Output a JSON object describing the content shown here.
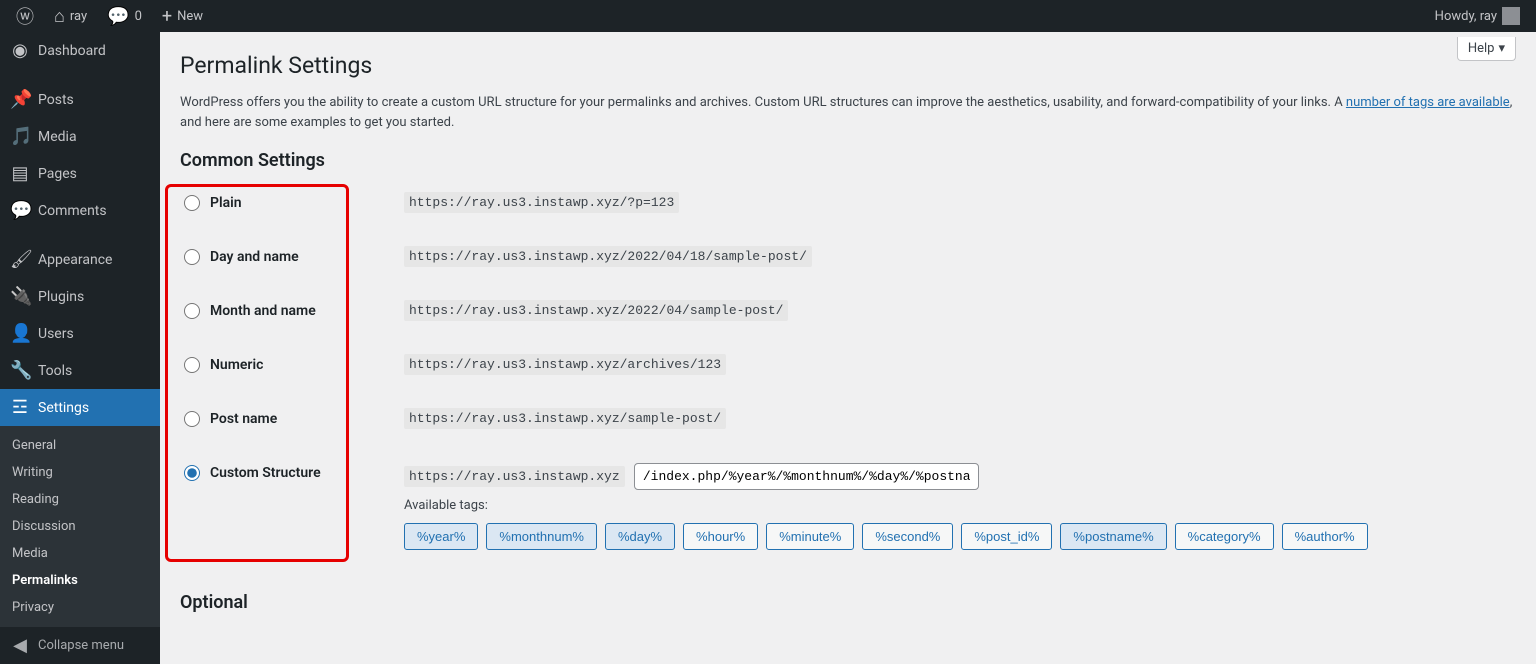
{
  "topbar": {
    "site": "ray",
    "comments": "0",
    "new": "New",
    "howdy": "Howdy, ray"
  },
  "menu": {
    "dashboard": "Dashboard",
    "posts": "Posts",
    "media": "Media",
    "pages": "Pages",
    "comments": "Comments",
    "appearance": "Appearance",
    "plugins": "Plugins",
    "users": "Users",
    "tools": "Tools",
    "settings": "Settings",
    "collapse": "Collapse menu"
  },
  "submenu": {
    "general": "General",
    "writing": "Writing",
    "reading": "Reading",
    "discussion": "Discussion",
    "media": "Media",
    "permalinks": "Permalinks",
    "privacy": "Privacy"
  },
  "help": "Help",
  "title": "Permalink Settings",
  "intro1": "WordPress offers you the ability to create a custom URL structure for your permalinks and archives. Custom URL structures can improve the aesthetics, usability, and forward-compatibility of your links. A ",
  "intro_link": "number of tags are available",
  "intro2": ", and here are some examples to get you started.",
  "common_heading": "Common Settings",
  "options": {
    "plain": {
      "label": "Plain",
      "example": "https://ray.us3.instawp.xyz/?p=123"
    },
    "day": {
      "label": "Day and name",
      "example": "https://ray.us3.instawp.xyz/2022/04/18/sample-post/"
    },
    "month": {
      "label": "Month and name",
      "example": "https://ray.us3.instawp.xyz/2022/04/sample-post/"
    },
    "numeric": {
      "label": "Numeric",
      "example": "https://ray.us3.instawp.xyz/archives/123"
    },
    "postname": {
      "label": "Post name",
      "example": "https://ray.us3.instawp.xyz/sample-post/"
    },
    "custom": {
      "label": "Custom Structure",
      "prefix": "https://ray.us3.instawp.xyz",
      "value": "/index.php/%year%/%monthnum%/%day%/%postnam"
    }
  },
  "available_label": "Available tags:",
  "tags": [
    "%year%",
    "%monthnum%",
    "%day%",
    "%hour%",
    "%minute%",
    "%second%",
    "%post_id%",
    "%postname%",
    "%category%",
    "%author%"
  ],
  "tags_active": [
    "%year%",
    "%monthnum%",
    "%day%",
    "%postname%"
  ],
  "optional_heading": "Optional"
}
